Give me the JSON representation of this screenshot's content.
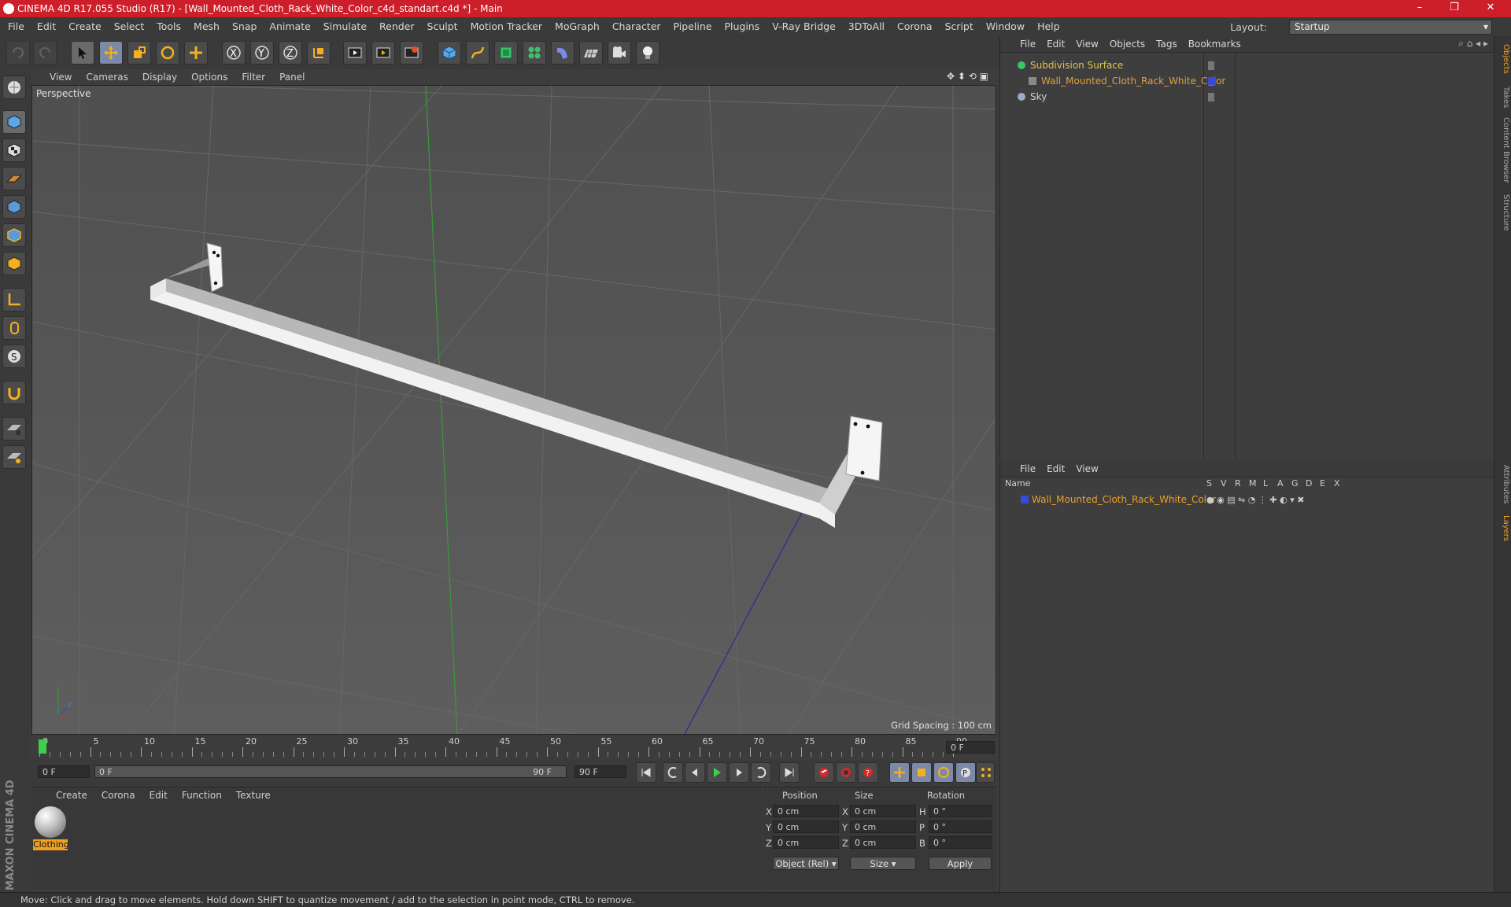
{
  "titlebar": {
    "title": "CINEMA 4D R17.055 Studio (R17) - [Wall_Mounted_Cloth_Rack_White_Color_c4d_standart.c4d *] - Main",
    "minimize": "–",
    "maximize": "❐",
    "close": "✕"
  },
  "menubar": {
    "items": [
      "File",
      "Edit",
      "Create",
      "Select",
      "Tools",
      "Mesh",
      "Snap",
      "Animate",
      "Simulate",
      "Render",
      "Sculpt",
      "Motion Tracker",
      "MoGraph",
      "Character",
      "Pipeline",
      "Plugins",
      "V-Ray Bridge",
      "3DToAll",
      "Corona",
      "Script",
      "Window",
      "Help"
    ],
    "layout_label": "Layout:",
    "layout_value": "Startup"
  },
  "viewport": {
    "menu": [
      "View",
      "Cameras",
      "Display",
      "Options",
      "Filter",
      "Panel"
    ],
    "label": "Perspective",
    "grid_spacing": "Grid Spacing : 100 cm"
  },
  "timeline": {
    "ticks": [
      "0",
      "5",
      "10",
      "15",
      "20",
      "25",
      "30",
      "35",
      "40",
      "45",
      "50",
      "55",
      "60",
      "65",
      "70",
      "75",
      "80",
      "85",
      "90"
    ],
    "current_frame": "0 F",
    "start_field": "0 F",
    "range_start": "0 F",
    "range_end": "90 F",
    "end_field": "90 F"
  },
  "material_manager": {
    "menu": [
      "Create",
      "Corona",
      "Edit",
      "Function",
      "Texture"
    ],
    "material_name": "Clothing"
  },
  "coordinates": {
    "headers": [
      "Position",
      "Size",
      "Rotation"
    ],
    "rows": [
      {
        "axis": "X",
        "pos": "0 cm",
        "saxis": "X",
        "size": "0 cm",
        "raxis": "H",
        "rot": "0 °"
      },
      {
        "axis": "Y",
        "pos": "0 cm",
        "saxis": "Y",
        "size": "0 cm",
        "raxis": "P",
        "rot": "0 °"
      },
      {
        "axis": "Z",
        "pos": "0 cm",
        "saxis": "Z",
        "size": "0 cm",
        "raxis": "B",
        "rot": "0 °"
      }
    ],
    "mode": "Object (Rel)",
    "size_mode": "Size",
    "apply": "Apply"
  },
  "object_manager": {
    "menu": [
      "File",
      "Edit",
      "View",
      "Objects",
      "Tags",
      "Bookmarks"
    ],
    "objects": [
      {
        "name": "Subdivision Surface",
        "color": "#e6c24a"
      },
      {
        "name": "Wall_Mounted_Cloth_Rack_White_Color",
        "color": "#e0a040"
      },
      {
        "name": "Sky",
        "color": "#cfcfcf"
      }
    ]
  },
  "layer_manager": {
    "menu": [
      "File",
      "Edit",
      "View"
    ],
    "columns": [
      "Name",
      "S",
      "V",
      "R",
      "M",
      "L",
      "A",
      "G",
      "D",
      "E",
      "X"
    ],
    "layer_name": "Wall_Mounted_Cloth_Rack_White_Color"
  },
  "right_tabs": [
    "Objects",
    "Takes",
    "Content Browser",
    "Structure",
    "Attributes",
    "Layers"
  ],
  "brand": "MAXON CINEMA 4D",
  "status": "Move: Click and drag to move elements. Hold down SHIFT to quantize movement / add to the selection in point mode, CTRL to remove.",
  "colors": {
    "title_red": "#cc1f2a",
    "accent_orange": "#f0a020",
    "viewport_bg": "#575757"
  }
}
